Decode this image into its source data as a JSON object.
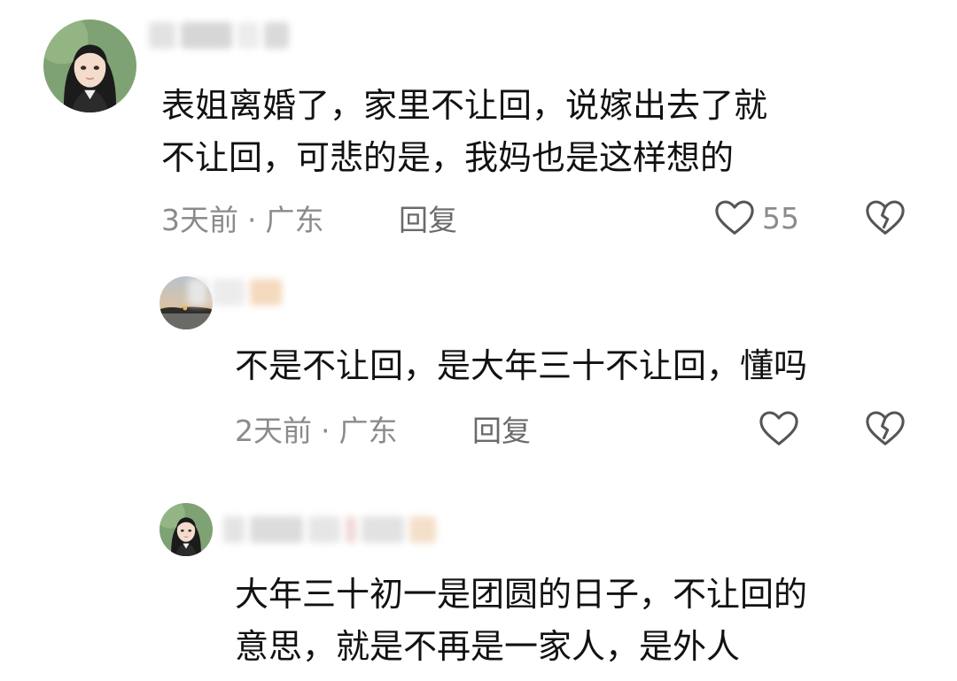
{
  "comments": [
    {
      "text_line1": "表姐离婚了，家里不让回，说嫁出去了就",
      "text_line2": "不让回，可悲的是，我妈也是这样想的",
      "time": "3天前",
      "separator": "·",
      "location": "广东",
      "reply_label": "回复",
      "like_count": "55",
      "like_icon": "heart-outline-icon",
      "dislike_icon": "broken-heart-icon"
    },
    {
      "text_line1": "不是不让回，是大年三十不让回，懂吗",
      "time": "2天前",
      "separator": "·",
      "location": "广东",
      "reply_label": "回复",
      "like_icon": "heart-outline-icon",
      "dislike_icon": "broken-heart-icon"
    },
    {
      "text_line1": "大年三十初一是团圆的日子，不让回的",
      "text_line2": "意思，就是不再是一家人，是外人"
    }
  ],
  "colors": {
    "text": "#111111",
    "meta": "#8b8b8b",
    "icon_stroke": "#555555",
    "avatar_green": "#6f9a67"
  }
}
